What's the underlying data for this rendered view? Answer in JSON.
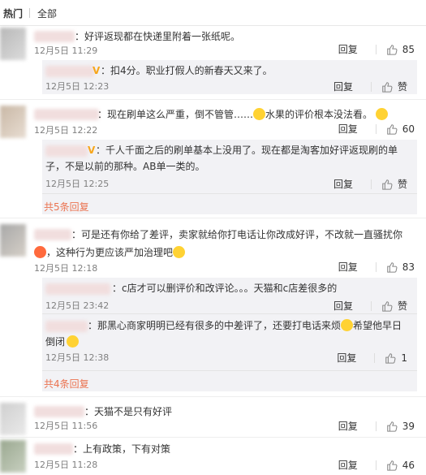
{
  "tabs": {
    "hot": "热门",
    "all": "全部"
  },
  "actions": {
    "reply": "回复",
    "like": "赞"
  },
  "comments": [
    {
      "text": "：好评返现都在快递里附着一张纸呢。",
      "time": "12月5日 11:29",
      "likes": "85"
    },
    {
      "text": "：现在刷单这么严重，倒不管管……",
      "text2": "水果的评价根本没法看。",
      "time": "12月5日 12:22",
      "likes": "60"
    },
    {
      "text": "：可是还有你给了差评，卖家就给你打电话让你改成好评，不改就一直骚扰你",
      "text_line2": "，这种行为更应该严加治理吧",
      "time": "12月5日 12:18",
      "likes": "83"
    },
    {
      "text": "：天猫不是只有好评",
      "time": "12月5日 11:56",
      "likes": "39"
    },
    {
      "text": "：上有政策，下有对策",
      "time": "12月5日 11:28",
      "likes": "46"
    }
  ],
  "replies": {
    "r1": {
      "text": "：扣4分。职业打假人的新春天又来了。",
      "time": "12月5日 12:23"
    },
    "r2": {
      "line1": "：千人千面之后的刷单基本上没用了。现在都是淘客加好评返现刷的单",
      "line2": "子，不是以前的那种。AB单一类的。",
      "time": "12月5日 12:25",
      "more": "共5条回复"
    },
    "r3": {
      "text": "：c店才可以删评价和改评论。。。天猫和c店差很多的",
      "time": "12月5日 23:42"
    },
    "r4": {
      "line1": "：那黑心商家明明已经有很多的中差评了，还要打电话来烦",
      "line1b": "希望他早日",
      "line2": "倒闭",
      "time": "12月5日 12:38",
      "likes": "1",
      "more": "共4条回复"
    }
  },
  "colors": {
    "accent": "#eb7350",
    "reply_bg": "#f2f2f5",
    "vbadge": "#f7a61b"
  }
}
